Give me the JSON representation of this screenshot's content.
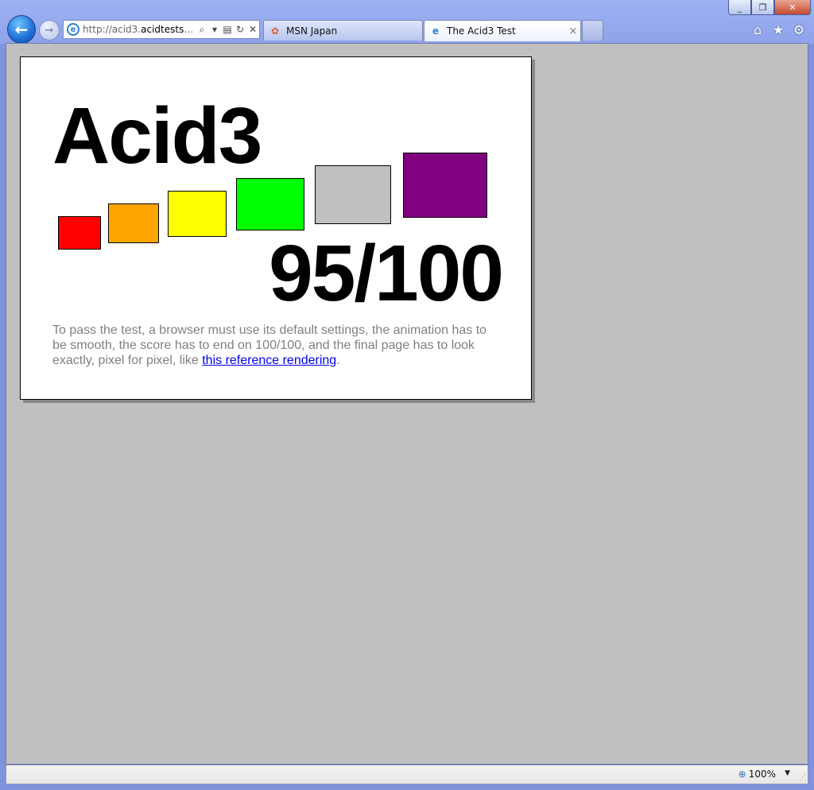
{
  "window": {
    "minimize_label": "_",
    "restore_label": "❐",
    "close_label": "✕"
  },
  "nav": {
    "back_icon": "←",
    "forward_icon": "→",
    "address": {
      "prefix": "http://acid3.",
      "host": "acidtests",
      "suffix": "...",
      "search_icon": "⌕",
      "dropdown_icon": "▾",
      "compat_icon": "▤",
      "refresh_icon": "↻",
      "stop_icon": "✕"
    },
    "tabs": [
      {
        "title": "MSN Japan",
        "favicon": "msn-butterfly-icon",
        "active": false
      },
      {
        "title": "The Acid3 Test",
        "favicon": "ie-page-icon",
        "active": true,
        "close": "×"
      }
    ],
    "tools": {
      "home": "⌂",
      "favorites": "★",
      "settings": "⚙"
    }
  },
  "page": {
    "title": "Acid3",
    "score": "95/100",
    "description_pre": "To pass the test, a browser must use its default settings, the animation has to be smooth, the score has to end on 100/100, and the final page has to look exactly, pixel for pixel, like ",
    "link_text": "this reference rendering",
    "description_post": ".",
    "boxes": [
      {
        "name": "red-box",
        "color": "#ff0000"
      },
      {
        "name": "orange-box",
        "color": "#ffa500"
      },
      {
        "name": "yellow-box",
        "color": "#ffff00"
      },
      {
        "name": "lime-box",
        "color": "#00ff00"
      },
      {
        "name": "silver-box",
        "color": "#c0c0c0"
      },
      {
        "name": "purple-box",
        "color": "#800080"
      }
    ]
  },
  "status": {
    "zoom_label": "100%",
    "zoom_dropdown": "▼"
  }
}
